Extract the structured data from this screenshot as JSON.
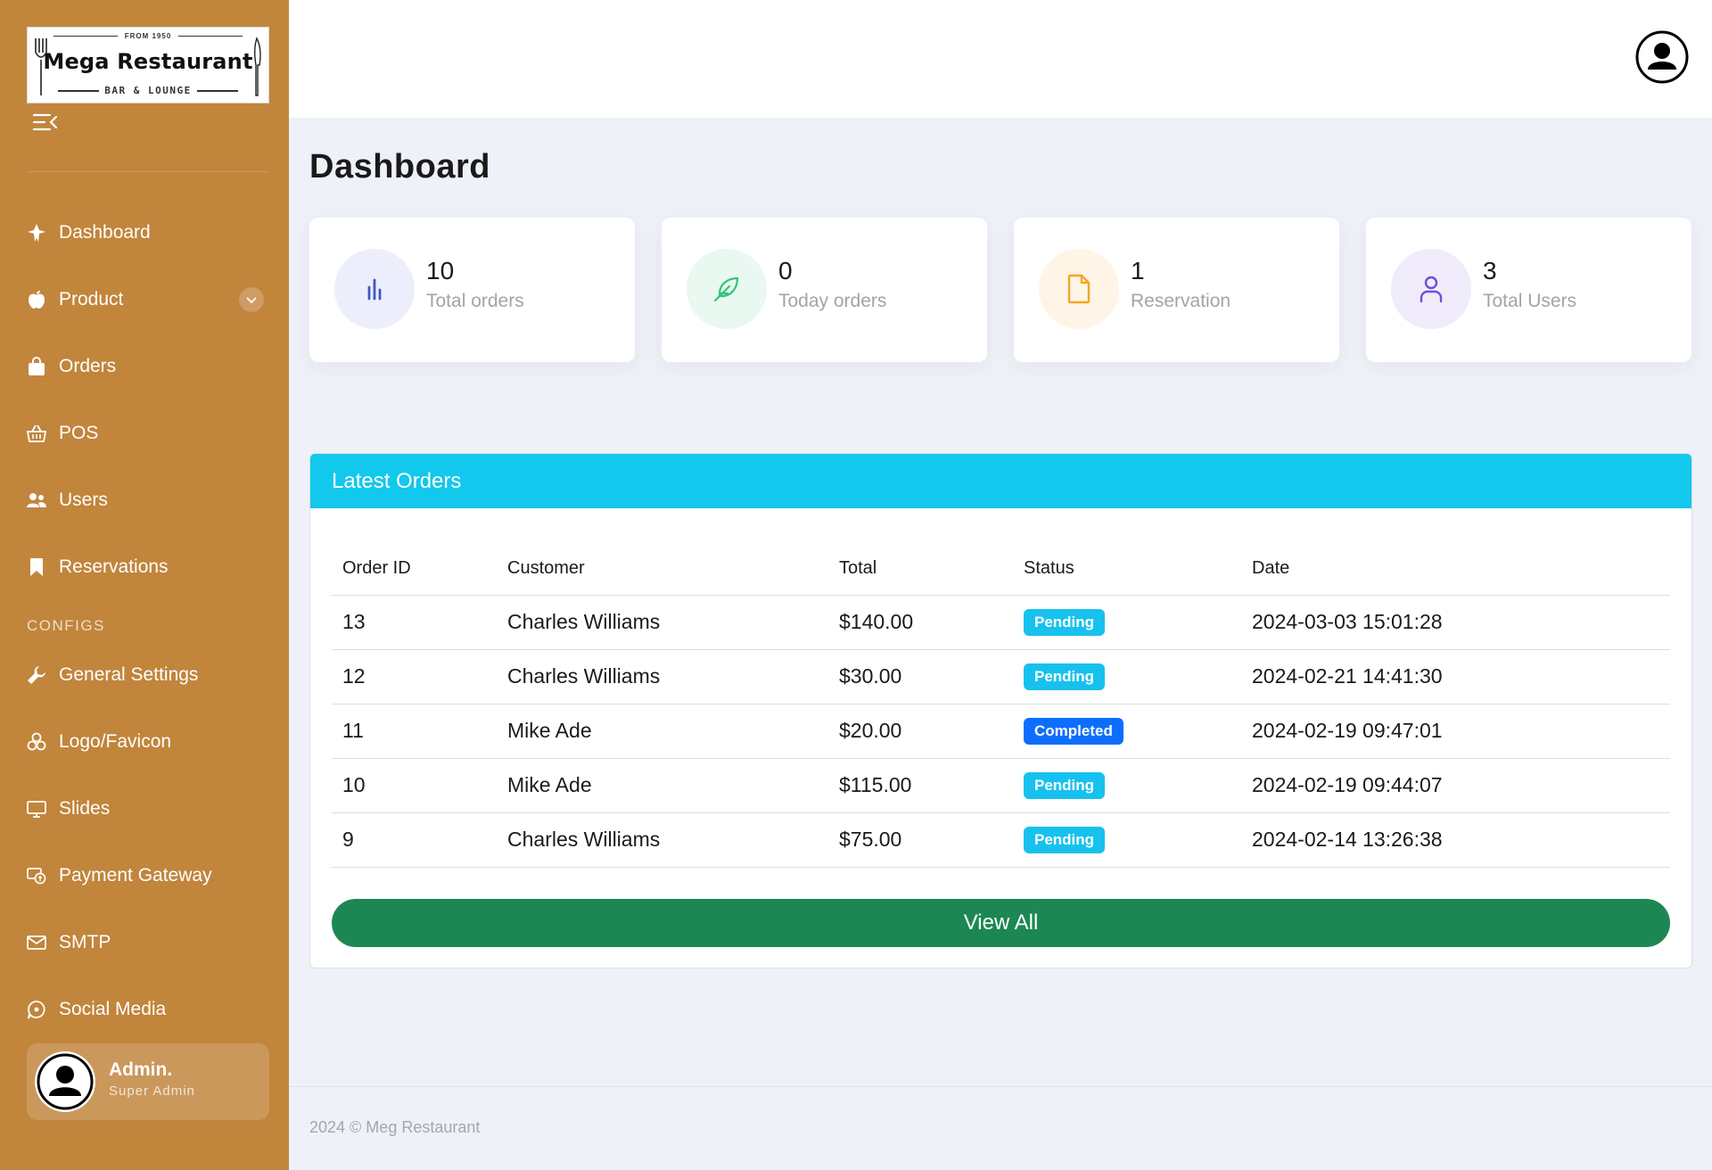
{
  "brand": {
    "tagline_top": "FROM 1950",
    "name": "Mega Restaurant",
    "tagline_bottom": "BAR & LOUNGE"
  },
  "sidebar": {
    "items": [
      {
        "label": "Dashboard",
        "icon": "rocket-icon"
      },
      {
        "label": "Product",
        "icon": "apple-icon"
      },
      {
        "label": "Orders",
        "icon": "bag-icon"
      },
      {
        "label": "POS",
        "icon": "basket-icon"
      },
      {
        "label": "Users",
        "icon": "users-icon"
      },
      {
        "label": "Reservations",
        "icon": "bookmark-icon"
      }
    ],
    "config_heading": "CONFIGS",
    "config_items": [
      {
        "label": "General Settings",
        "icon": "wrench-icon"
      },
      {
        "label": "Logo/Favicon",
        "icon": "grid-icon"
      },
      {
        "label": "Slides",
        "icon": "monitor-icon"
      },
      {
        "label": "Payment Gateway",
        "icon": "payment-icon"
      },
      {
        "label": "SMTP",
        "icon": "envelope-icon"
      },
      {
        "label": "Social Media",
        "icon": "chat-icon"
      }
    ],
    "admin": {
      "name": "Admin.",
      "role": "Super Admin"
    }
  },
  "page": {
    "title": "Dashboard"
  },
  "stats": [
    {
      "value": "10",
      "label": "Total orders",
      "icon": "bar-chart-icon",
      "color": "#4355c4",
      "bg": "#eceffb"
    },
    {
      "value": "0",
      "label": "Today orders",
      "icon": "feather-icon",
      "color": "#2ec47a",
      "bg": "#e9f8f0"
    },
    {
      "value": "1",
      "label": "Reservation",
      "icon": "file-icon",
      "color": "#f5a623",
      "bg": "#fef5e7"
    },
    {
      "value": "3",
      "label": "Total Users",
      "icon": "user-icon",
      "color": "#6c4fd8",
      "bg": "#f0ecfb"
    }
  ],
  "orders": {
    "title": "Latest Orders",
    "columns": [
      "Order ID",
      "Customer",
      "Total",
      "Status",
      "Date"
    ],
    "rows": [
      {
        "id": "13",
        "customer": "Charles Williams",
        "total": "$140.00",
        "status": "Pending",
        "date": "2024-03-03 15:01:28"
      },
      {
        "id": "12",
        "customer": "Charles Williams",
        "total": "$30.00",
        "status": "Pending",
        "date": "2024-02-21 14:41:30"
      },
      {
        "id": "11",
        "customer": "Mike Ade",
        "total": "$20.00",
        "status": "Completed",
        "date": "2024-02-19 09:47:01"
      },
      {
        "id": "10",
        "customer": "Mike Ade",
        "total": "$115.00",
        "status": "Pending",
        "date": "2024-02-19 09:44:07"
      },
      {
        "id": "9",
        "customer": "Charles Williams",
        "total": "$75.00",
        "status": "Pending",
        "date": "2024-02-14 13:26:38"
      }
    ],
    "view_all_label": "View All"
  },
  "footer": {
    "text": "2024 © Meg Restaurant"
  },
  "colors": {
    "sidebar": "#c1853c",
    "header": "#12c8ec",
    "view_all": "#1d8754",
    "pending": "#17c1ee",
    "completed": "#0d6efd"
  }
}
